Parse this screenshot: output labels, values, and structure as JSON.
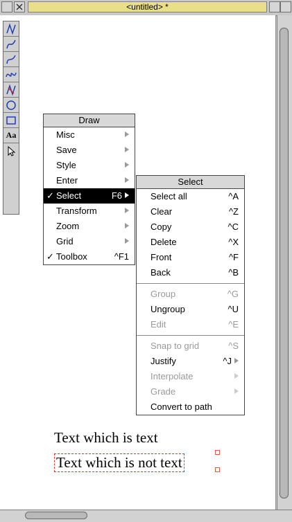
{
  "window": {
    "title": "<untitled> *"
  },
  "draw_menu": {
    "title": "Draw",
    "items": [
      {
        "label": "Misc",
        "submenu": true
      },
      {
        "label": "Save",
        "submenu": true
      },
      {
        "label": "Style",
        "submenu": true
      },
      {
        "label": "Enter",
        "submenu": true
      },
      {
        "label": "Select",
        "key": "F6",
        "checked": true,
        "highlighted": true,
        "submenu": true
      },
      {
        "label": "Transform",
        "submenu": true
      },
      {
        "label": "Zoom",
        "submenu": true
      },
      {
        "label": "Grid",
        "submenu": true
      },
      {
        "label": "Toolbox",
        "key": "^F1",
        "checked": true
      }
    ]
  },
  "select_menu": {
    "title": "Select",
    "items": [
      {
        "label": "Select all",
        "key": "^A"
      },
      {
        "label": "Clear",
        "key": "^Z"
      },
      {
        "label": "Copy",
        "key": "^C"
      },
      {
        "label": "Delete",
        "key": "^X"
      },
      {
        "label": "Front",
        "key": "^F"
      },
      {
        "label": "Back",
        "key": "^B"
      },
      {
        "label": "Group",
        "key": "^G",
        "disabled": true
      },
      {
        "label": "Ungroup",
        "key": "^U"
      },
      {
        "label": "Edit",
        "key": "^E",
        "disabled": true
      },
      {
        "label": "Snap to grid",
        "key": "^S",
        "disabled": true
      },
      {
        "label": "Justify",
        "key": "^J",
        "submenu": true
      },
      {
        "label": "Interpolate",
        "disabled": true,
        "submenu": true
      },
      {
        "label": "Grade",
        "disabled": true,
        "submenu": true
      },
      {
        "label": "Convert to path"
      }
    ]
  },
  "document": {
    "text_1": "Text which is text",
    "text_2": "Text which is not text"
  },
  "toolbox": {
    "tools": [
      "path-line-icon",
      "path-curve-icon",
      "path-bezier-icon",
      "path-move-icon",
      "path-closed-icon",
      "ellipse-icon",
      "rectangle-icon",
      "text-tool-icon",
      "select-arrow-icon"
    ],
    "text_tool_glyph": "Aa"
  },
  "colors": {
    "title_bg": "#e9df86",
    "menu_highlight": "#000000",
    "disabled_text": "#9a9a9a",
    "tool_blue": "#1e3fb3"
  }
}
